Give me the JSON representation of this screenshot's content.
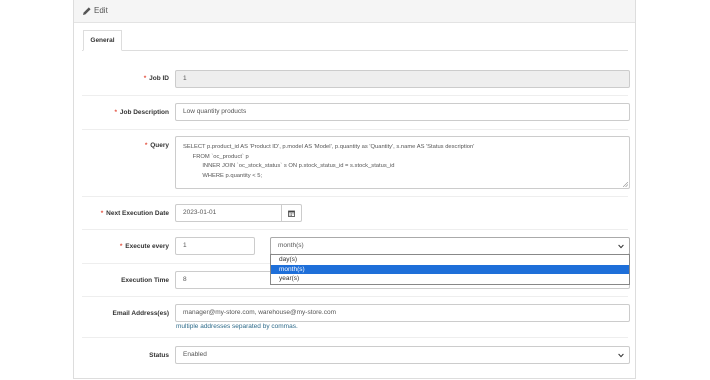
{
  "panel": {
    "title": "Edit",
    "icon": "pencil-icon"
  },
  "tabs": [
    {
      "label": "General"
    }
  ],
  "form": {
    "job_id": {
      "label": "Job ID",
      "required": true,
      "value": "1"
    },
    "job_description": {
      "label": "Job Description",
      "required": true,
      "value": "Low quantity products"
    },
    "query": {
      "label": "Query",
      "required": true,
      "lines": [
        "SELECT p.product_id AS 'Product ID', p.model AS 'Model', p.quantity as 'Quantity', s.name AS 'Status description'",
        "      FROM `oc_product` p",
        "            INNER JOIN `oc_stock_status` s ON p.stock_status_id = s.stock_status_id",
        "            WHERE p.quantity < 5;"
      ]
    },
    "next_execution_date": {
      "label": "Next Execution Date",
      "required": true,
      "value": "2023-01-01",
      "icon": "calendar-icon"
    },
    "execute_every": {
      "label": "Execute every",
      "required": true,
      "value": "1",
      "unit_selected": "month(s)",
      "unit_options": [
        "day(s)",
        "month(s)",
        "year(s)"
      ]
    },
    "execution_time": {
      "label": "Execution Time",
      "required": false,
      "value": "8"
    },
    "email_addresses": {
      "label": "Email Address(es)",
      "required": false,
      "value": "manager@my-store.com, warehouse@my-store.com",
      "help": "multiple addresses separated by commas."
    },
    "status": {
      "label": "Status",
      "required": false,
      "value": "Enabled"
    }
  },
  "colors": {
    "required_star": "#e3503e",
    "selected_option": "#1e6fd9",
    "help_text": "#2e6b8a"
  }
}
